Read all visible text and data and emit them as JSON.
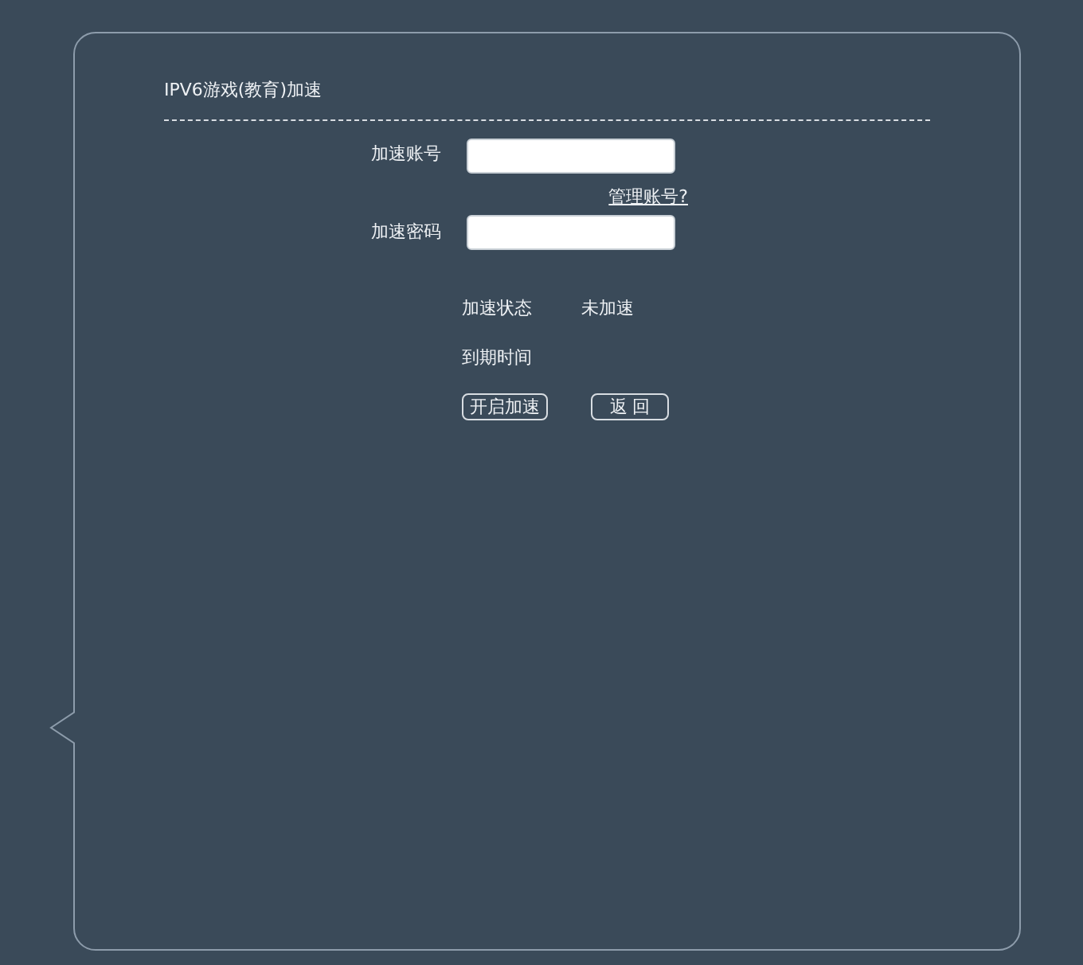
{
  "panel": {
    "title": "IPV6游戏(教育)加速"
  },
  "fields": [
    {
      "label": "加速账号"
    },
    {
      "label": "加速密码"
    }
  ],
  "manage_link": "管理账号?",
  "status": [
    {
      "label": "加速状态",
      "value": "未加速"
    },
    {
      "label": "到期时间"
    }
  ],
  "buttons": [
    "开启加速",
    "返 回"
  ]
}
